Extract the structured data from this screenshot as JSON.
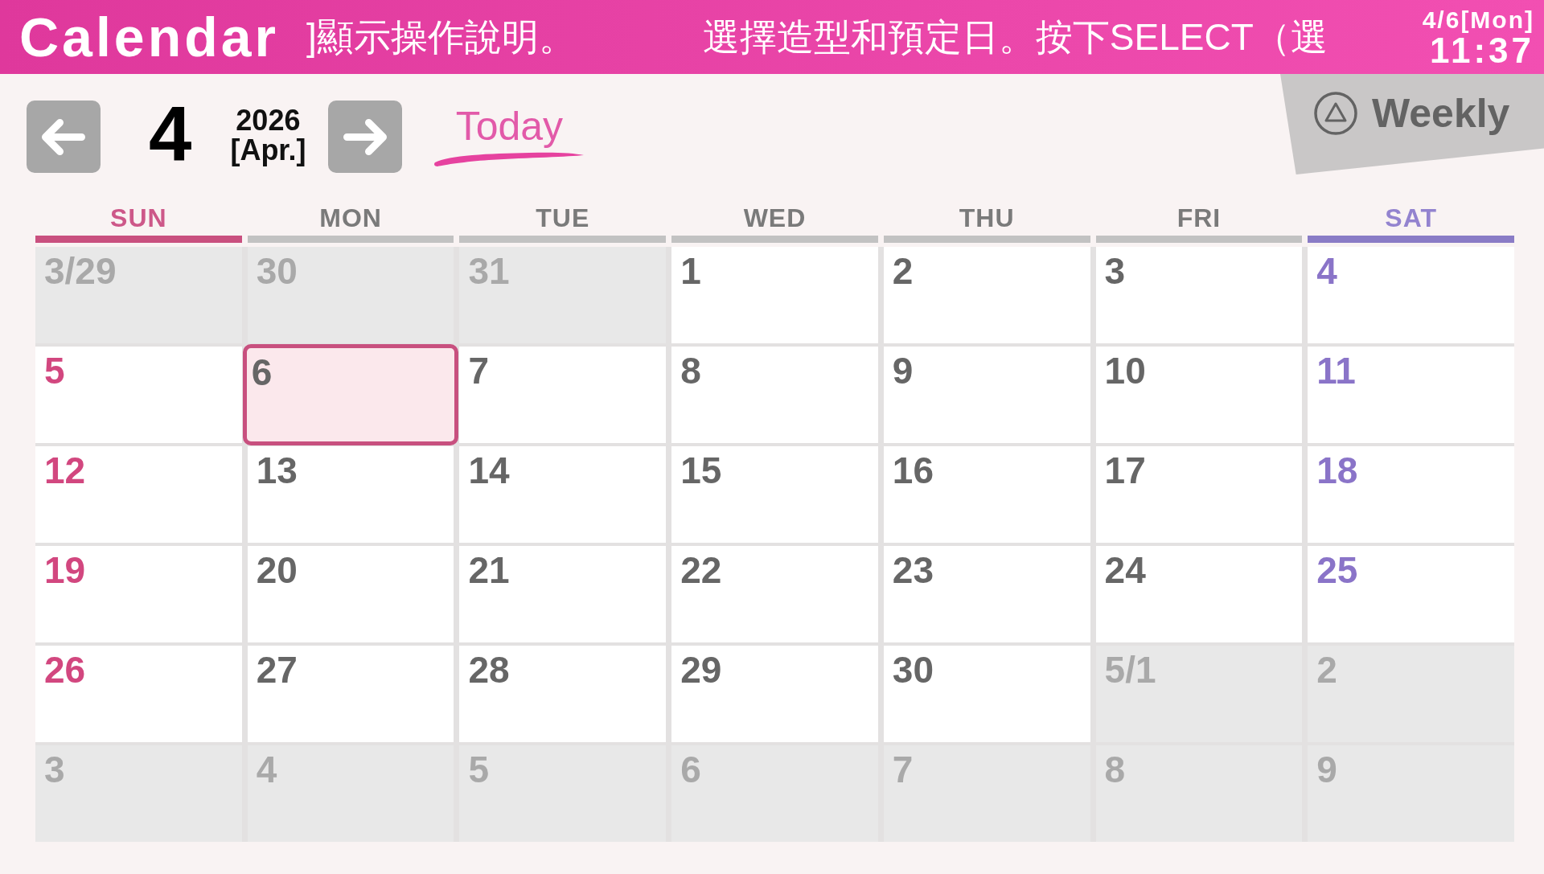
{
  "header": {
    "title": "Calendar",
    "ticker": [
      "]顯示操作說明。",
      "選擇造型和預定日。按下SELECT（選"
    ],
    "date": "4/6[Mon]",
    "time": "11:37"
  },
  "month_nav": {
    "month": "4",
    "year": "2026",
    "month_name": "[Apr.]",
    "today": "Today"
  },
  "view_tab": {
    "label": "Weekly"
  },
  "weekdays": [
    {
      "label": "SUN",
      "kind": "sunday",
      "color": "#c9507f"
    },
    {
      "label": "MON",
      "kind": "weekday",
      "color": "#c2c2c2"
    },
    {
      "label": "TUE",
      "kind": "weekday",
      "color": "#c2c2c2"
    },
    {
      "label": "WED",
      "kind": "weekday",
      "color": "#c2c2c2"
    },
    {
      "label": "THU",
      "kind": "weekday",
      "color": "#c2c2c2"
    },
    {
      "label": "FRI",
      "kind": "weekday",
      "color": "#c2c2c2"
    },
    {
      "label": "SAT",
      "kind": "saturday",
      "color": "#8a7cc6"
    }
  ],
  "weeks": [
    {
      "days": [
        {
          "label": "3/29",
          "in_month": false,
          "selected": false
        },
        {
          "label": "30",
          "in_month": false,
          "selected": false
        },
        {
          "label": "31",
          "in_month": false,
          "selected": false
        },
        {
          "label": "1",
          "in_month": true,
          "selected": false
        },
        {
          "label": "2",
          "in_month": true,
          "selected": false
        },
        {
          "label": "3",
          "in_month": true,
          "selected": false
        },
        {
          "label": "4",
          "in_month": true,
          "selected": false
        }
      ]
    },
    {
      "days": [
        {
          "label": "5",
          "in_month": true,
          "selected": false
        },
        {
          "label": "6",
          "in_month": true,
          "selected": true
        },
        {
          "label": "7",
          "in_month": true,
          "selected": false
        },
        {
          "label": "8",
          "in_month": true,
          "selected": false
        },
        {
          "label": "9",
          "in_month": true,
          "selected": false
        },
        {
          "label": "10",
          "in_month": true,
          "selected": false
        },
        {
          "label": "11",
          "in_month": true,
          "selected": false
        }
      ]
    },
    {
      "days": [
        {
          "label": "12",
          "in_month": true,
          "selected": false
        },
        {
          "label": "13",
          "in_month": true,
          "selected": false
        },
        {
          "label": "14",
          "in_month": true,
          "selected": false
        },
        {
          "label": "15",
          "in_month": true,
          "selected": false
        },
        {
          "label": "16",
          "in_month": true,
          "selected": false
        },
        {
          "label": "17",
          "in_month": true,
          "selected": false
        },
        {
          "label": "18",
          "in_month": true,
          "selected": false
        }
      ]
    },
    {
      "days": [
        {
          "label": "19",
          "in_month": true,
          "selected": false
        },
        {
          "label": "20",
          "in_month": true,
          "selected": false
        },
        {
          "label": "21",
          "in_month": true,
          "selected": false
        },
        {
          "label": "22",
          "in_month": true,
          "selected": false
        },
        {
          "label": "23",
          "in_month": true,
          "selected": false
        },
        {
          "label": "24",
          "in_month": true,
          "selected": false
        },
        {
          "label": "25",
          "in_month": true,
          "selected": false
        }
      ]
    },
    {
      "days": [
        {
          "label": "26",
          "in_month": true,
          "selected": false
        },
        {
          "label": "27",
          "in_month": true,
          "selected": false
        },
        {
          "label": "28",
          "in_month": true,
          "selected": false
        },
        {
          "label": "29",
          "in_month": true,
          "selected": false
        },
        {
          "label": "30",
          "in_month": true,
          "selected": false
        },
        {
          "label": "5/1",
          "in_month": false,
          "selected": false
        },
        {
          "label": "2",
          "in_month": false,
          "selected": false
        }
      ]
    },
    {
      "days": [
        {
          "label": "3",
          "in_month": false,
          "selected": false
        },
        {
          "label": "4",
          "in_month": false,
          "selected": false
        },
        {
          "label": "5",
          "in_month": false,
          "selected": false
        },
        {
          "label": "6",
          "in_month": false,
          "selected": false
        },
        {
          "label": "7",
          "in_month": false,
          "selected": false
        },
        {
          "label": "8",
          "in_month": false,
          "selected": false
        },
        {
          "label": "9",
          "in_month": false,
          "selected": false
        }
      ]
    }
  ]
}
